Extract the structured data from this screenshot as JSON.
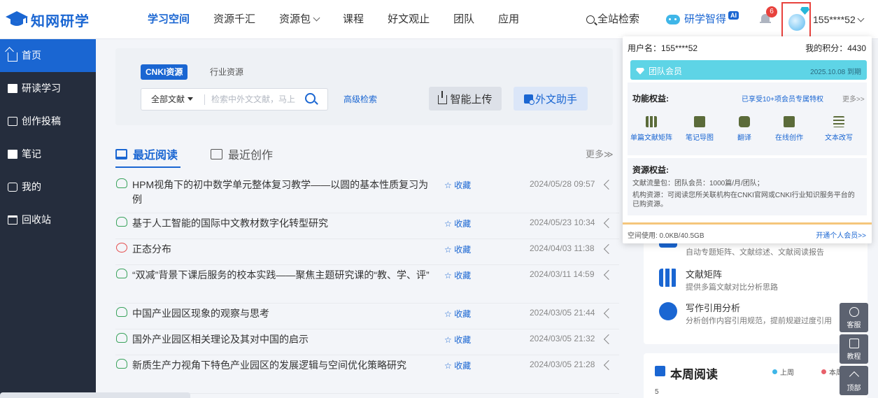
{
  "header": {
    "logo_text": "知网研学",
    "nav": [
      {
        "label": "学习空间",
        "active": true
      },
      {
        "label": "资源千汇"
      },
      {
        "label": "资源包",
        "has_caret": true
      },
      {
        "label": "课程"
      },
      {
        "label": "好文观止"
      },
      {
        "label": "团队"
      },
      {
        "label": "应用"
      }
    ],
    "site_search_label": "全站检索",
    "ai_label": "研学智得",
    "ai_badge": "AI",
    "notification_count": "6",
    "username": "155****52"
  },
  "sidebar": {
    "items": [
      {
        "label": "首页",
        "icon": "home-icon",
        "active": true
      },
      {
        "label": "研读学习",
        "icon": "read-icon"
      },
      {
        "label": "创作投稿",
        "icon": "write-icon"
      },
      {
        "label": "笔记",
        "icon": "note-icon"
      },
      {
        "label": "我的",
        "icon": "mine-icon"
      },
      {
        "label": "回收站",
        "icon": "trash-icon"
      }
    ]
  },
  "search": {
    "tab_active": "CNKI资源",
    "tab_other": "行业资源",
    "scope": "全部文献",
    "placeholder": "检索中外文文献，马上",
    "advanced": "高级检索",
    "smart_upload": "智能上传",
    "foreign_helper": "外文助手"
  },
  "reading": {
    "tab_recent_read": "最近阅读",
    "tab_recent_create": "最近创作",
    "more": "更多≫",
    "fav_label": "☆ 收藏",
    "rows": [
      {
        "title": "HPM视角下的初中数学单元整体复习教学——以圆的基本性质复习为例",
        "time": "2024/05/28 09:57",
        "type": "doc",
        "tall": true
      },
      {
        "title": "基于人工智能的国际中文教材数字化转型研究",
        "time": "2024/05/23 10:34",
        "type": "doc"
      },
      {
        "title": "正态分布",
        "time": "2024/04/03 11:38",
        "type": "pdf"
      },
      {
        "title": "“双减”背景下课后服务的校本实践——聚焦主题研究课的“教、学、评”",
        "time": "2024/03/11 14:59",
        "type": "doc",
        "tall": true
      },
      {
        "title": "中国产业园区现象的观察与思考",
        "time": "2024/03/05 21:44",
        "type": "doc"
      },
      {
        "title": "国外产业园区相关理论及其对中国的启示",
        "time": "2024/03/05 21:32",
        "type": "doc"
      },
      {
        "title": "新质生产力视角下特色产业园区的发展逻辑与空间优化策略研究",
        "time": "2024/03/05 21:28",
        "type": "doc",
        "tall": true
      }
    ]
  },
  "right_panel": {
    "items": [
      {
        "title": "",
        "desc": "自动专题矩阵、文献综述、文献阅读报告",
        "icon": "ai-icon",
        "color": "#1a66d2"
      },
      {
        "title": "文献矩阵",
        "desc": "提供多篇文献对比分析思路",
        "icon": "matrix-icon",
        "color": "#1a66d2"
      },
      {
        "title": "写作引用分析",
        "desc": "分析创作内容引用规范，提前规避过度引用",
        "icon": "quote-icon",
        "color": "#1a66d2"
      }
    ],
    "week_title": "本周阅读",
    "legend_last": "上周",
    "legend_this": "本周",
    "y_tick": "5"
  },
  "float_tools": [
    {
      "label": "客服",
      "icon": "service-icon"
    },
    {
      "label": "教程",
      "icon": "tutorial-icon"
    },
    {
      "label": "顶部",
      "icon": "top-icon"
    }
  ],
  "dropdown": {
    "user_line": "用户名：155****52",
    "points_line": "我的积分：4430",
    "member_name": "团队会员",
    "member_expire": "2025.10.08 到期",
    "benefits_title": "功能权益:",
    "benefits_vip": "已享受10+项会员专属特权",
    "benefits_more": "更多>>",
    "features": [
      {
        "label": "单篇文献矩阵",
        "icon": "matrix-icon"
      },
      {
        "label": "笔记导图",
        "icon": "mindmap-icon"
      },
      {
        "label": "翻译",
        "icon": "translate-icon"
      },
      {
        "label": "在线创作",
        "icon": "write-icon"
      },
      {
        "label": "文本改写",
        "icon": "rewrite-icon"
      }
    ],
    "res_title": "资源权益:",
    "res_line1": "文献流量包：团队会员：1000篇/月/团队；",
    "res_line2": "机构资源：可阅读您所关联机构在CNKI官网或CNKI行业知识服务平台的已购资源。",
    "space_used": "空间使用: 0.0KB/40.5GB",
    "upgrade": "开通个人会员>>"
  },
  "colors": {
    "brand": "#1a66d2",
    "sidebar_bg": "#252d3d",
    "member_teal": "#5ed4e6",
    "alert_red": "#e8423d"
  }
}
